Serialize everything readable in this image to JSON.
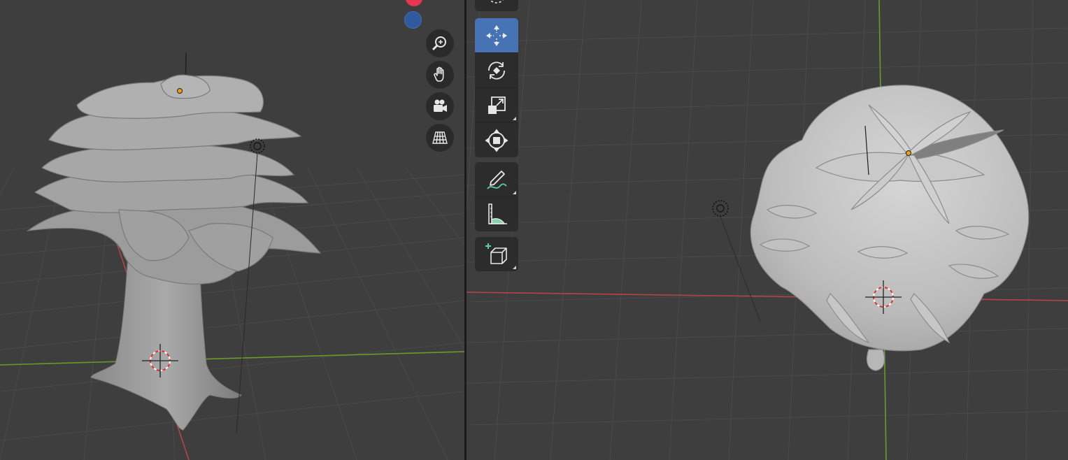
{
  "colors": {
    "viewport_bg": "#3e3e3e",
    "grid": "#4a4a4a",
    "x_axis": "#b54545",
    "y_axis": "#6a9a2c",
    "active_tool": "#4772b3",
    "panel": "#2c2c2c",
    "gizmo_x": "#e7364f",
    "gizmo_z": "#2f5a9e",
    "origin_dot": "#f39b1b",
    "model": "#bdbdbd"
  },
  "left_viewport": {
    "nav_buttons": [
      {
        "name": "zoom-view-icon",
        "icon": "magnifier-plus"
      },
      {
        "name": "pan-view-icon",
        "icon": "hand"
      },
      {
        "name": "camera-view-icon",
        "icon": "camera"
      },
      {
        "name": "perspective-toggle-icon",
        "icon": "grid-perspective"
      }
    ]
  },
  "toolbar": {
    "tools": [
      {
        "name": "move-tool",
        "icon": "move-arrows",
        "active": true,
        "has_submenu": false
      },
      {
        "name": "rotate-tool",
        "icon": "rotate",
        "active": false,
        "has_submenu": false
      },
      {
        "name": "scale-tool",
        "icon": "scale",
        "active": false,
        "has_submenu": true
      },
      {
        "name": "transform-tool",
        "icon": "transform",
        "active": false,
        "has_submenu": false
      },
      {
        "name": "annotate-tool",
        "icon": "pencil",
        "active": false,
        "has_submenu": true
      },
      {
        "name": "measure-tool",
        "icon": "ruler-protractor",
        "active": false,
        "has_submenu": false
      },
      {
        "name": "add-cube-tool",
        "icon": "cube-plus",
        "active": false,
        "has_submenu": true
      }
    ]
  }
}
